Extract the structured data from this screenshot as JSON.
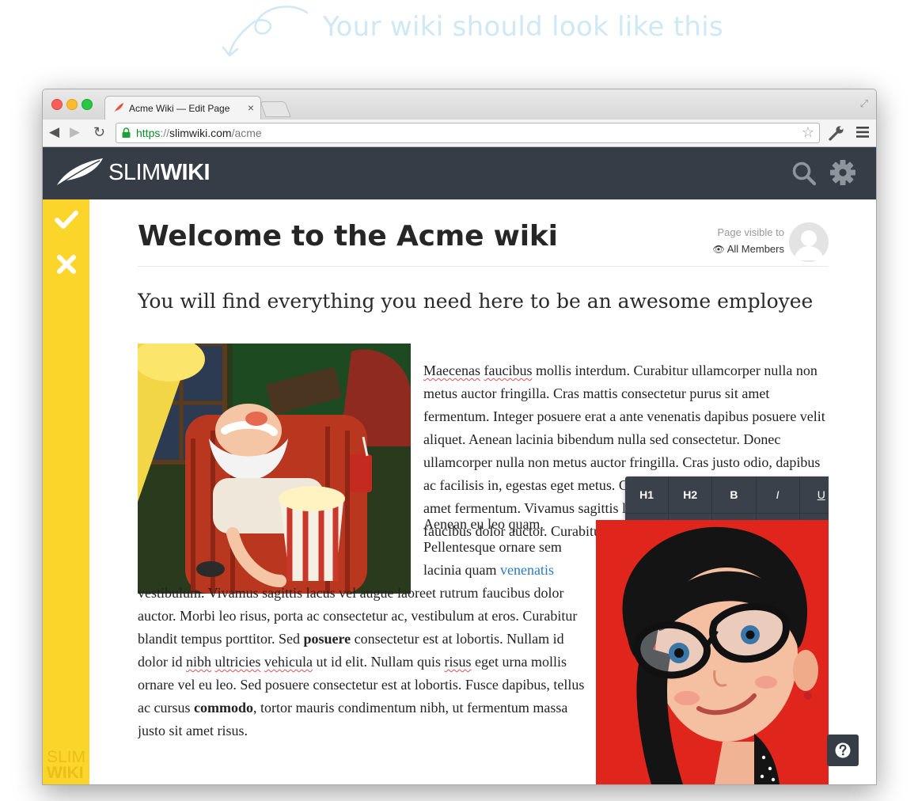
{
  "hint": {
    "text": "Your wiki should look like this"
  },
  "browser": {
    "tab_title": "Acme Wiki — Edit Page",
    "tab_close": "×",
    "url_scheme": "https",
    "url_sep": "://",
    "url_host": "slimwiki.com",
    "url_path": "/acme"
  },
  "app": {
    "logo_slim": "SLIM",
    "logo_wiki": "WIKI",
    "sidebar_logo_top": "SLIM",
    "sidebar_logo_bottom": "WIKI"
  },
  "page": {
    "title": "Welcome to the Acme wiki",
    "visibility_label": "Page visible to",
    "visibility_value": "All Members",
    "subtitle": "You will find everything you need here to be an awesome employee"
  },
  "para1": {
    "w1": "Maecenas",
    "w2": "faucibus",
    "t1": " mollis interdum. Curabitur ullamcorper nulla non metus auctor fringilla. Cras mattis consectetur purus sit amet fermentum. Integer posuere erat a ante venenatis dapibus posuere velit aliquet. Aenean lacinia bibendum nulla sed consectetur. Donec ullamcorper nulla non metus auctor fringilla. Cras justo odio, dapibus ac facilisis in, egestas eget metus. Cras mattis consectetur purus sit amet fermentum. Vivamus sagittis lacus vel augue laoreet rutrum faucibus dolor auctor. Curabitur ",
    "w3": "blandit",
    "t2": " tempus ",
    "w4": "porttitor",
    "t3": "."
  },
  "para2": {
    "t1": "Aenean eu leo quam. Pellentesque ornare sem lacinia quam ",
    "link": "venenatis",
    "t2": " vestibulum. Vivamus sagittis lacus vel augue laoreet rutrum faucibus dolor auctor. Morbi leo risus, porta ac consectetur ac, vestibulum at eros. Curabitur blandit tempus porttitor. Sed ",
    "b1": "posuere",
    "t3": " consectetur est at lobortis. Nullam id dolor id ",
    "w1": "nibh",
    "s1": " ",
    "w2": "ultricies",
    "s2": " ",
    "w3": "vehicula",
    "t4": " ut id elit. Nullam quis ",
    "w4": "risus",
    "t5": " eget urna mollis ornare vel eu leo. Sed posuere consectetur est at lobortis. Fusce dapibus, tellus ac cursus ",
    "b2": "commodo",
    "t6": ", tortor mauris condimentum nibh, ut fermentum massa justo sit amet risus."
  },
  "format_toolbar": {
    "h1": "H1",
    "h2": "H2",
    "bold": "B",
    "italic": "I",
    "underline": "U"
  },
  "colors": {
    "header_bg": "#363d47",
    "sidebar_bg": "#fcd52a",
    "link": "#2b7bbd",
    "selection": "#b4d6f8"
  }
}
